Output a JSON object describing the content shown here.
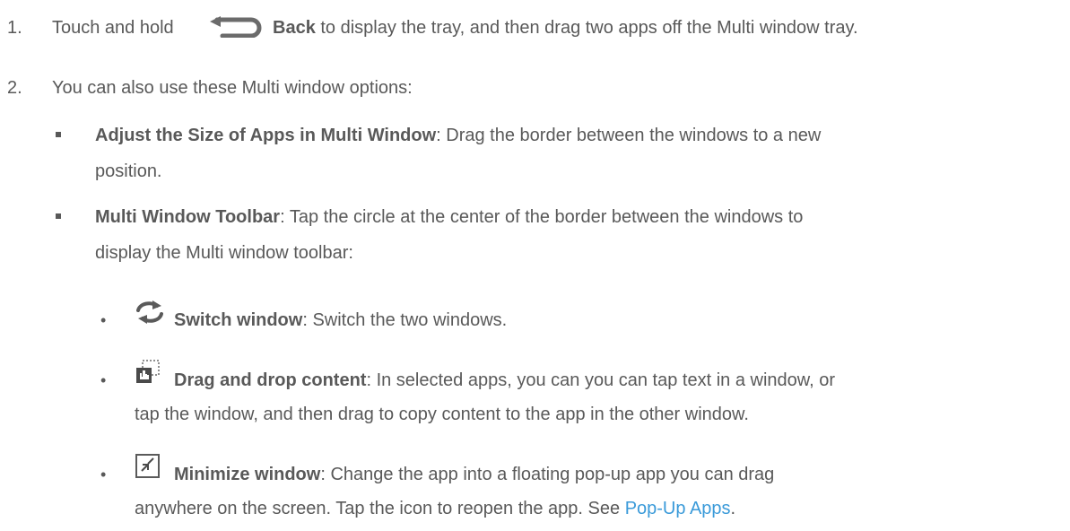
{
  "steps": [
    {
      "number": "1.",
      "pre": "Touch and hold",
      "icon": "back-arrow-icon",
      "bold": "Back",
      "post": "to display the tray, and then drag two apps off the Multi window tray."
    },
    {
      "number": "2.",
      "text": "You can also use these Multi window options:"
    }
  ],
  "options": [
    {
      "bold": "Adjust the Size of Apps in Multi Window",
      "line1": ": Drag the border between the windows to a new",
      "line2": "position."
    },
    {
      "bold": "Multi Window Toolbar",
      "line1": ": Tap the circle at the center of the border between the windows to",
      "line2": "display the Multi window toolbar:"
    }
  ],
  "toolbar_items": [
    {
      "icon": "switch-window-icon",
      "bold": "Switch window",
      "line1": ": Switch the two windows."
    },
    {
      "icon": "drag-and-drop-icon",
      "bold": "Drag and drop content",
      "line1": ": In selected apps, you can you can tap text in a window, or",
      "line2": "tap the window, and then drag to copy content to the app in the other window."
    },
    {
      "icon": "minimize-window-icon",
      "bold": "Minimize window",
      "line1": ": Change the app into a floating pop-up app you can drag",
      "line2_pre": "anywhere on the screen. Tap the icon to reopen the app. See ",
      "link": "Pop-Up Apps",
      "line2_post": "."
    }
  ],
  "bullet_char": "•",
  "colors": {
    "text": "#595959",
    "link": "#3a9ad9"
  }
}
